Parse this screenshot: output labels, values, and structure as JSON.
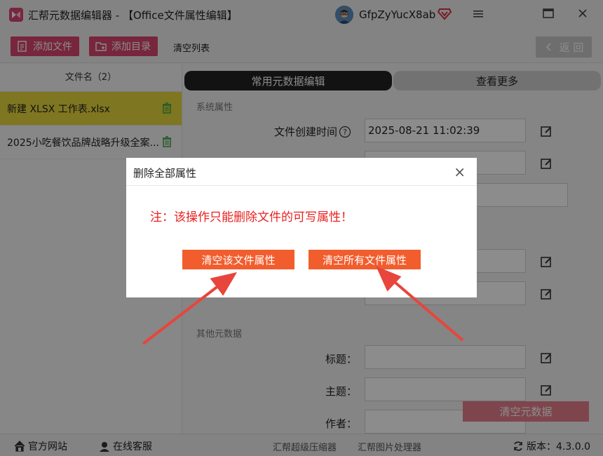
{
  "window": {
    "title": "汇帮元数据编辑器 - 【Office文件属性编辑】",
    "username": "GfpZyYucX8ab",
    "icons": {
      "logo": "app-logo-icon",
      "vip": "vip-diamond-icon",
      "menu": "menu-icon",
      "maximize": "maximize-icon",
      "close": "close-icon"
    },
    "accent_color": "#d9456f"
  },
  "toolbar": {
    "add_file": "添加文件",
    "add_folder": "添加目录",
    "clear_list": "清空列表",
    "back": "返 回"
  },
  "file_list": {
    "header": "文件名（2）",
    "items": [
      {
        "name": "新建 XLSX 工作表.xlsx",
        "selected": true
      },
      {
        "name": "2025小吃餐饮品牌战略升级全案...",
        "selected": false
      }
    ]
  },
  "tabs": {
    "active": "常用元数据编辑",
    "more": "查看更多"
  },
  "form": {
    "section_system": "系统属性",
    "created_label": "文件创建时间",
    "created_value": "2025-08-21 11:02:39",
    "section_other": "其他元数据",
    "title_label": "标题：",
    "subject_label": "主题：",
    "author_label": "作者："
  },
  "clear_metadata": "清空元数据",
  "statusbar": {
    "website": "官方网站",
    "support": "在线客服",
    "compressor": "汇帮超级压缩器",
    "image_tool": "汇帮图片处理器",
    "version": "版本：4.3.0.0"
  },
  "dialog": {
    "title": "删除全部属性",
    "close": "×",
    "note": "注：该操作只能删除文件的可写属性！",
    "btn_clear_this": "清空该文件属性",
    "btn_clear_all": "清空所有文件属性",
    "button_color": "#f25d2d",
    "note_color": "#e8211f"
  }
}
